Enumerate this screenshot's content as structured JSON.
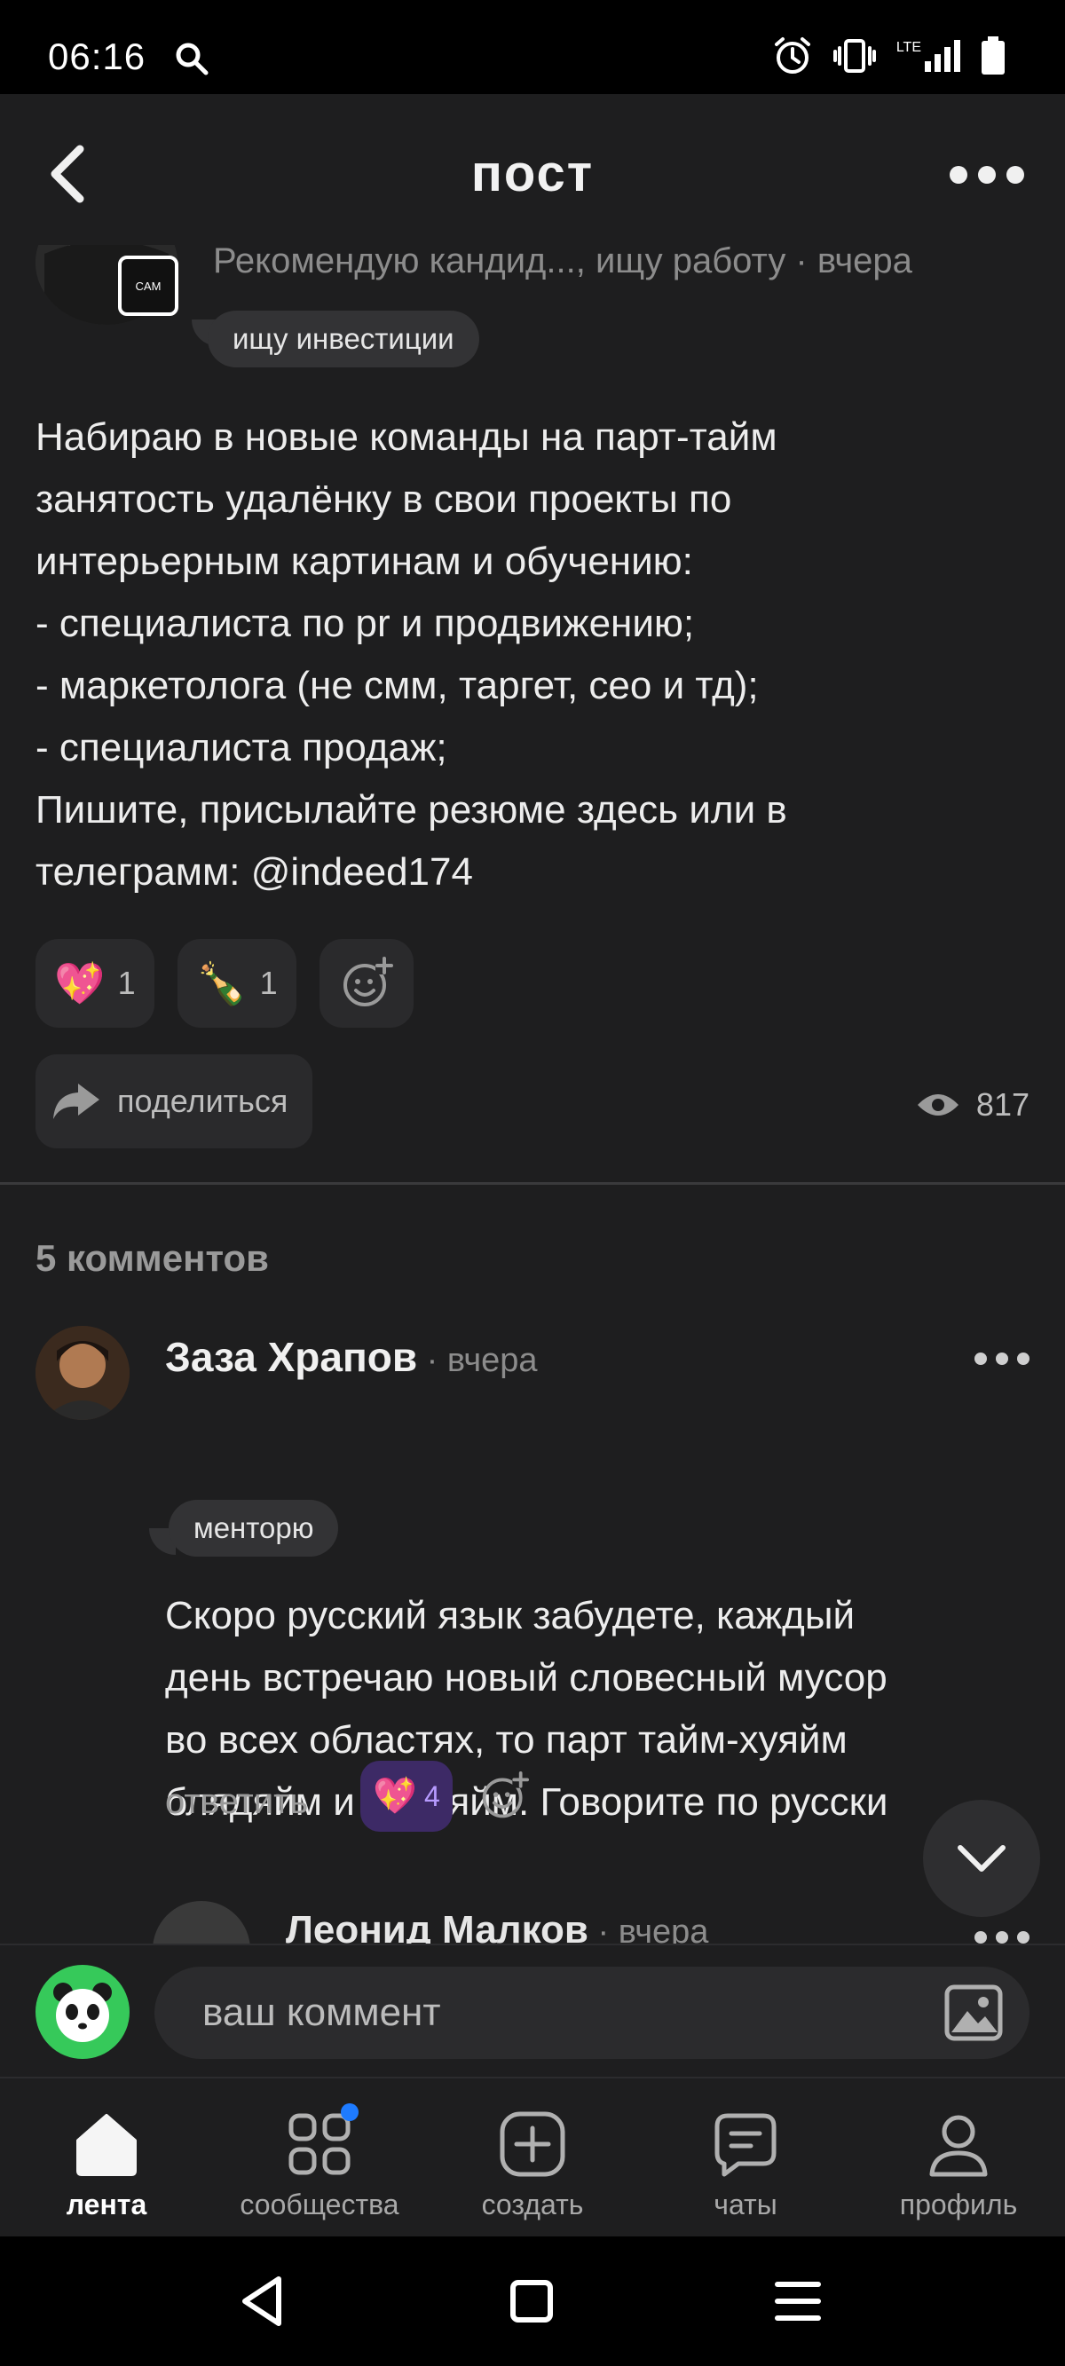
{
  "status_bar": {
    "time": "06:16",
    "network": "LTE",
    "icons": [
      "search-icon",
      "alarm-icon",
      "vibrate-icon",
      "lte-signal-icon",
      "battery-icon"
    ]
  },
  "header": {
    "title": "пост",
    "back_icon": "chevron-left-icon",
    "more_icon": "more-horizontal-icon"
  },
  "post": {
    "author_badge": "CAM",
    "meta": "Рекомендую кандид..., ищу работу · вчера",
    "tag": "ищу инвестиции",
    "text_lines": [
      "Набираю в новые команды на парт-тайм",
      "занятость удалёнку в свои проекты по",
      "интерьерным картинам и обучению:",
      "- специалиста по pr и продвижению;",
      "- маркетолога (не смм, таргет, сео и тд);",
      "- специалиста продаж;",
      "Пишите, присылайте резюме здесь или в",
      "телеграмм: @indeed174"
    ],
    "reactions": [
      {
        "emoji": "💖",
        "count": "1"
      },
      {
        "emoji": "🍾",
        "count": "1"
      }
    ],
    "add_reaction_icon": "add-reaction-icon",
    "share_label": "поделиться",
    "views": "817"
  },
  "comments": {
    "count_label": "5 комментов",
    "items": [
      {
        "author": "Заза Храпов",
        "time": " · вчера",
        "tag": "менторю",
        "text_lines": [
          "Скоро русский язык забудете, каждый",
          "день встречаю новый словесный мусор",
          "во всех областях, то парт тайм-хуяйм",
          "блядяйм и пиздяйм. Говорите по русски"
        ],
        "reply_label": "ответить",
        "reaction": {
          "emoji": "💖",
          "count": "4"
        }
      }
    ],
    "partial_next": {
      "author": "Леонид Малков",
      "time": " · вчера"
    }
  },
  "composer": {
    "placeholder": "ваш коммент"
  },
  "tabbar": {
    "items": [
      {
        "label": "лента",
        "active": true
      },
      {
        "label": "сообщества",
        "badge": true
      },
      {
        "label": "создать"
      },
      {
        "label": "чаты"
      },
      {
        "label": "профиль"
      }
    ]
  },
  "colors": {
    "background": "#1e1e1f",
    "pill": "#333335",
    "reaction_active": "#3d2a66",
    "badge_blue": "#1e7bff",
    "panda_green": "#36c95a"
  }
}
